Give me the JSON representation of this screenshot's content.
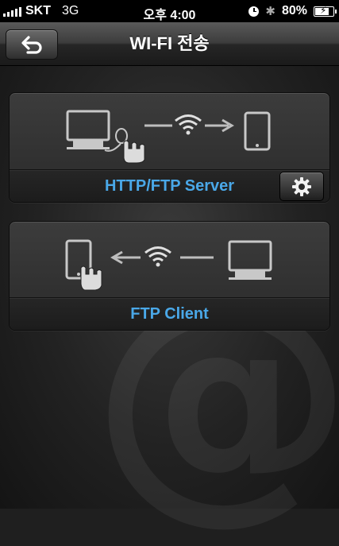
{
  "status_bar": {
    "carrier": "SKT",
    "network": "3G",
    "time": "오후 4:00",
    "battery_percent": "80%",
    "battery_level": 0.8,
    "icons": [
      "signal-icon",
      "alarm-clock-icon",
      "bluetooth-icon",
      "battery-charging-icon"
    ]
  },
  "nav": {
    "title": "WI-FI 전송",
    "back_icon": "back-arrow-icon"
  },
  "panels": [
    {
      "label": "HTTP/FTP Server",
      "icons": [
        "computer-monitor-icon",
        "hand-pointer-icon",
        "arrow-right-icon",
        "wifi-icon",
        "tablet-icon"
      ],
      "has_settings": true,
      "settings_icon": "gear-icon"
    },
    {
      "label": "FTP Client",
      "icons": [
        "tablet-icon",
        "hand-pointer-icon",
        "arrow-left-icon",
        "wifi-icon",
        "computer-monitor-icon"
      ],
      "has_settings": false
    }
  ],
  "colors": {
    "accent_label": "#4aa8e8",
    "background": "#1f1f1f"
  }
}
